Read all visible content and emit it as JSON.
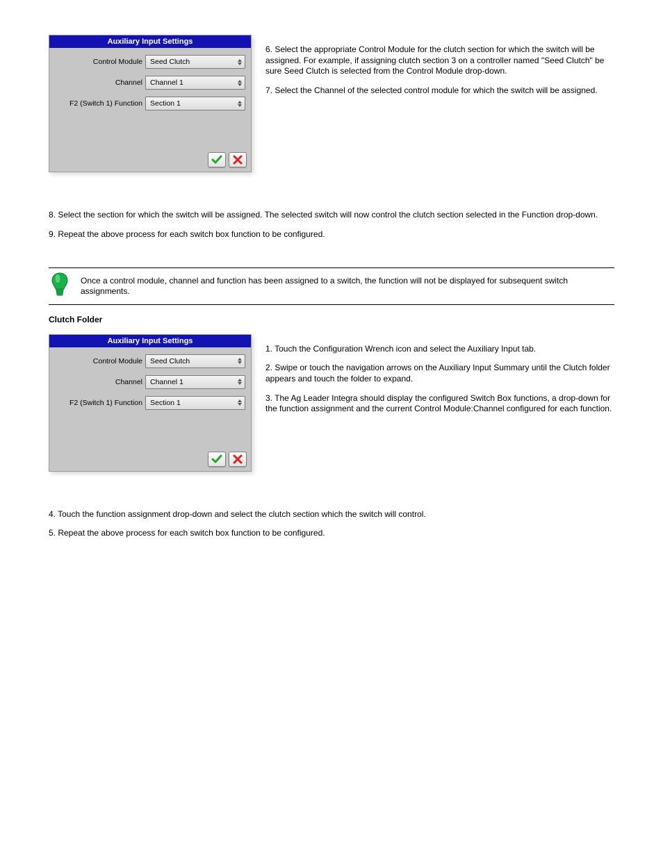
{
  "dialog1": {
    "title": "Auxiliary Input Settings",
    "rows": {
      "control_module_label": "Control Module",
      "control_module_value": "Seed Clutch",
      "channel_label": "Channel",
      "channel_value": "Channel 1",
      "function_label": "F2 (Switch 1) Function",
      "function_value": "Section 1"
    }
  },
  "section1": {
    "step6": "6. Select the appropriate Control Module for the clutch section for which the switch will be assigned. For example, if assigning clutch section 3 on a controller named \"Seed Clutch\" be sure Seed Clutch is selected from the Control Module drop-down.",
    "step7": "7. Select the Channel of the selected control module for which the switch will be assigned.",
    "step8": "8. Select the section for which the switch will be assigned. The selected switch will now control the clutch section selected in the Function drop-down.",
    "step9": "9. Repeat the above process for each switch box function to be configured."
  },
  "hint": "Once a control module, channel and function has been assigned to a switch, the function will not be displayed for subsequent switch assignments.",
  "heading_clutch": "Clutch Folder",
  "dialog2": {
    "title": "Auxiliary Input Settings",
    "rows": {
      "control_module_label": "Control Module",
      "control_module_value": "Seed Clutch",
      "channel_label": "Channel",
      "channel_value": "Channel 1",
      "function_label": "F2 (Switch 1) Function",
      "function_value": "Section 1"
    }
  },
  "section2": {
    "step1": "1. Touch the Configuration Wrench icon and select the Auxiliary Input tab.",
    "step2": "2. Swipe or touch the navigation arrows on the Auxiliary Input Summary until the Clutch folder appears and touch the folder to expand.",
    "step3": "3. The Ag Leader Integra should display the configured Switch Box functions, a drop-down for the function assignment and the current Control Module:Channel configured for each function.",
    "step4": "4. Touch the function assignment drop-down and select the clutch section which the switch will control.",
    "step5": "5. Repeat the above process for each switch box function to be configured."
  }
}
